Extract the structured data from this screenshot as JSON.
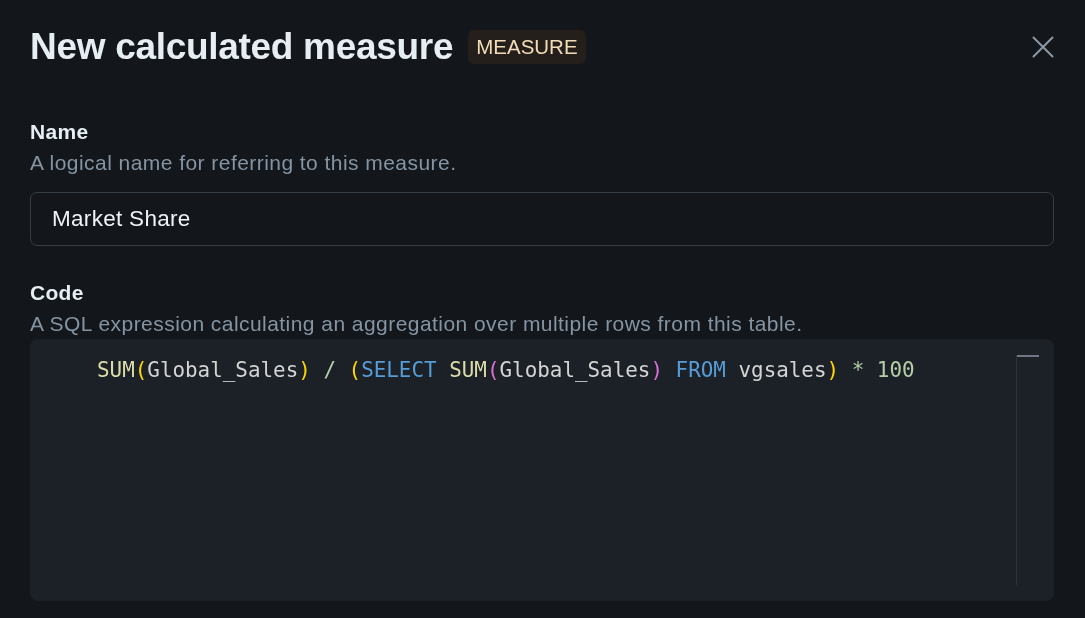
{
  "dialog": {
    "title": "New calculated measure",
    "badge": "MEASURE"
  },
  "fields": [
    {
      "kind": "text",
      "label": "Name",
      "description": "A logical name for referring to this measure.",
      "value": "Market Share"
    },
    {
      "kind": "code",
      "label": "Code",
      "description": "A SQL expression calculating an aggregation over multiple rows from this table.",
      "lines": [
        {
          "tokens": [
            {
              "text": "SUM",
              "kind": "function"
            },
            {
              "text": "(",
              "kind": "bracket",
              "color": "#ffd700"
            },
            {
              "text": "Global_Sales",
              "kind": "identifier"
            },
            {
              "text": ")",
              "kind": "bracket",
              "color": "#ffd700"
            },
            {
              "text": " / ",
              "kind": "operator"
            },
            {
              "text": "(",
              "kind": "bracket",
              "color": "#ffd700"
            },
            {
              "text": "SELECT",
              "kind": "keyword"
            },
            {
              "text": " SUM",
              "kind": "function"
            },
            {
              "text": "(",
              "kind": "bracket",
              "color": "#da70d6"
            },
            {
              "text": "Global_Sales",
              "kind": "identifier"
            },
            {
              "text": ")",
              "kind": "bracket",
              "color": "#da70d6"
            },
            {
              "text": " FROM",
              "kind": "keyword"
            },
            {
              "text": " vgsales",
              "kind": "identifier"
            },
            {
              "text": ")",
              "kind": "bracket",
              "color": "#ffd700"
            },
            {
              "text": " *",
              "kind": "operator"
            },
            {
              "text": " 100",
              "kind": "number"
            }
          ]
        }
      ]
    }
  ]
}
